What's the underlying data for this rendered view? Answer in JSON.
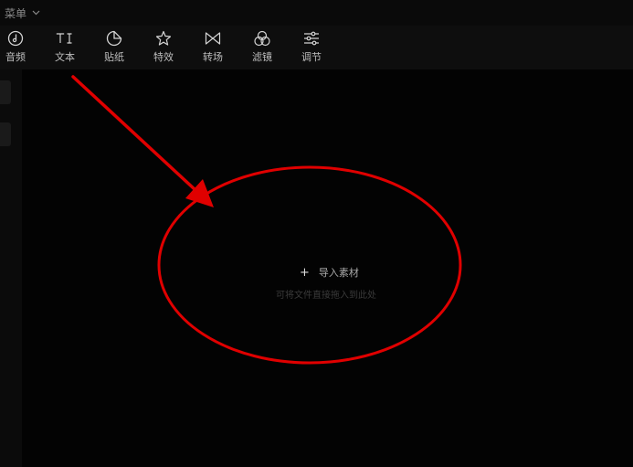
{
  "menubar": {
    "menu_label": "菜单"
  },
  "toolbar": {
    "items": [
      {
        "label": "音频",
        "icon": "audio-icon"
      },
      {
        "label": "文本",
        "icon": "text-icon"
      },
      {
        "label": "贴纸",
        "icon": "sticker-icon"
      },
      {
        "label": "特效",
        "icon": "effects-icon"
      },
      {
        "label": "转场",
        "icon": "transition-icon"
      },
      {
        "label": "滤镜",
        "icon": "filter-icon"
      },
      {
        "label": "调节",
        "icon": "adjust-icon"
      }
    ]
  },
  "import": {
    "plus": "+",
    "label": "导入素材",
    "hint": "可将文件直接拖入到此处"
  },
  "colors": {
    "background": "#020202",
    "toolbar_bg": "#0e0e0e",
    "annotation_red": "#e00000"
  }
}
